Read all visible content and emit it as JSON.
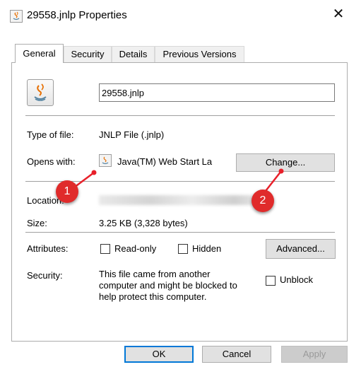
{
  "window": {
    "title": "29558.jnlp Properties",
    "close_glyph": "✕"
  },
  "tabs": [
    {
      "label": "General",
      "active": true
    },
    {
      "label": "Security",
      "active": false
    },
    {
      "label": "Details",
      "active": false
    },
    {
      "label": "Previous Versions",
      "active": false
    }
  ],
  "general": {
    "filename": "29558.jnlp",
    "type_label": "Type of file:",
    "type_value": "JNLP File (.jnlp)",
    "opens_label": "Opens with:",
    "opens_value": "Java(TM) Web Start La",
    "change_button": "Change...",
    "location_label": "Location:",
    "size_label": "Size:",
    "size_value": "3.25 KB (3,328 bytes)",
    "attributes_label": "Attributes:",
    "readonly_label": "Read-only",
    "hidden_label": "Hidden",
    "advanced_button": "Advanced...",
    "security_label": "Security:",
    "security_text_1": "This file came from another",
    "security_text_2": "computer and might be blocked to",
    "security_text_3": "help protect this computer.",
    "unblock_label": "Unblock"
  },
  "footer": {
    "ok": "OK",
    "cancel": "Cancel",
    "apply": "Apply"
  },
  "annotations": {
    "badge_1": "1",
    "badge_2": "2",
    "color": "#e02b2b"
  },
  "icons": [
    "java-icon",
    "close-icon",
    "checkbox-icon"
  ]
}
